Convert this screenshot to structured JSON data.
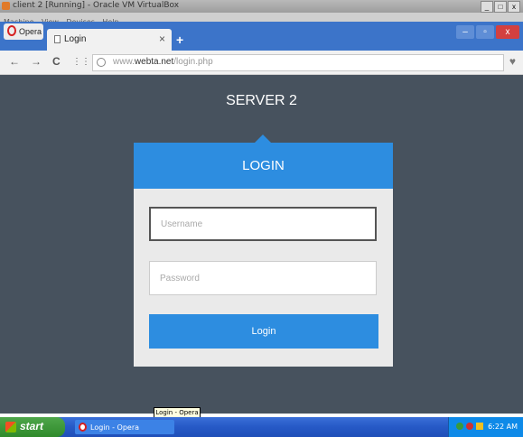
{
  "vbox": {
    "title": "client 2 [Running] - Oracle VM VirtualBox",
    "menu": [
      "Machine",
      "View",
      "Devices",
      "Help"
    ],
    "controls": [
      "_",
      "□",
      "x"
    ]
  },
  "opera": {
    "menu_label": "Opera",
    "tab_title": "Login",
    "tab_close": "×",
    "new_tab": "+",
    "win_controls": [
      "–",
      "▫",
      "x"
    ]
  },
  "addr": {
    "back": "←",
    "forward": "→",
    "reload": "C",
    "speed_dial": "⋮⋮",
    "url_prefix": "www.",
    "url_domain": "webta.net",
    "url_path": "/login.php",
    "heart": "♥"
  },
  "page": {
    "heading": "SERVER 2",
    "card_title": "LOGIN",
    "username_placeholder": "Username",
    "password_placeholder": "Password",
    "login_button": "Login"
  },
  "tooltip": "Login - Opera",
  "taskbar": {
    "start": "start",
    "task_label": "Login - Opera",
    "clock": "6:22 AM"
  },
  "colors": {
    "accent": "#2d8de0",
    "background": "#47525e",
    "card_body": "#eaeaea"
  }
}
